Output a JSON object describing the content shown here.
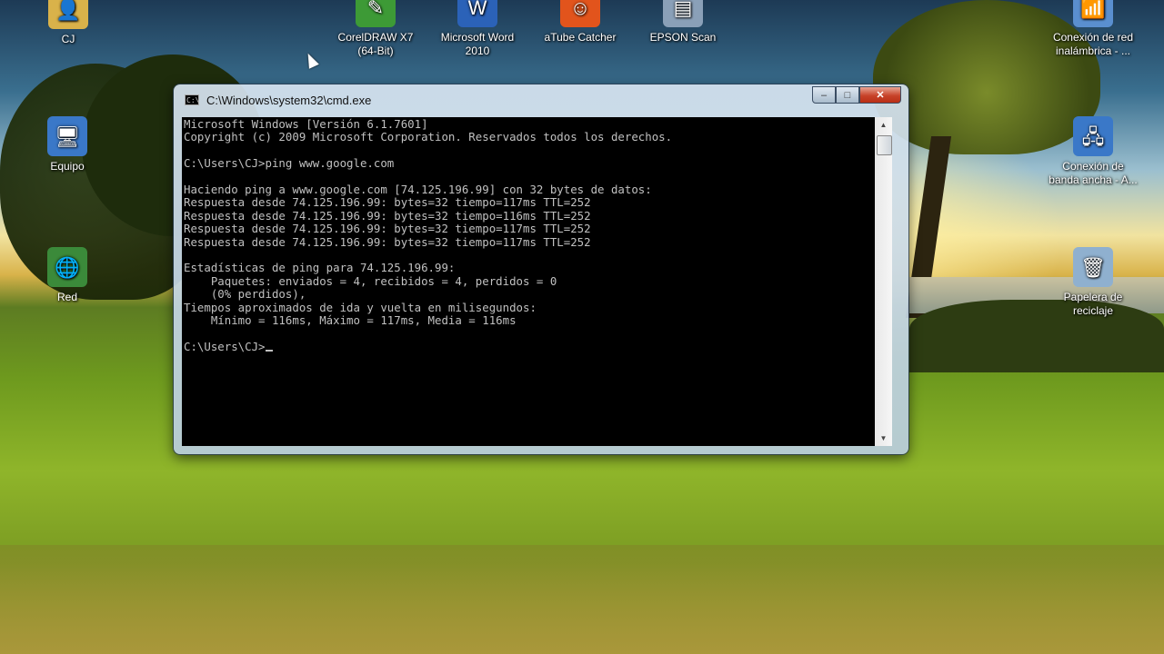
{
  "desktop": {
    "icons": [
      {
        "label": "CJ",
        "glyph": "👤",
        "color": "#d9b24a"
      },
      {
        "label": "CorelDRAW X7\n(64-Bit)",
        "glyph": "✎",
        "color": "#3d9a36"
      },
      {
        "label": "Microsoft Word\n2010",
        "glyph": "W",
        "color": "#2b62b8"
      },
      {
        "label": "aTube Catcher",
        "glyph": "☺",
        "color": "#e2541c"
      },
      {
        "label": "EPSON Scan",
        "glyph": "▤",
        "color": "#8aa0b8"
      },
      {
        "label": "Conexión de red\ninalámbrica - ...",
        "glyph": "📶",
        "color": "#5a8fcf"
      },
      {
        "label": "Equipo",
        "glyph": "🖥",
        "color": "#3a78c8"
      },
      {
        "label": "Conexión de\nbanda ancha - A...",
        "glyph": "🖧",
        "color": "#3a78c8"
      },
      {
        "label": "Red",
        "glyph": "🌐",
        "color": "#3b8a3a"
      },
      {
        "label": "Papelera de\nreciclaje",
        "glyph": "🗑",
        "color": "#8fb0cf"
      }
    ]
  },
  "window": {
    "title": "C:\\Windows\\system32\\cmd.exe",
    "icon": "cmd-icon",
    "controls": {
      "minimize": "–",
      "maximize": "□",
      "close": "✕"
    }
  },
  "console": {
    "lines": [
      "Microsoft Windows [Versión 6.1.7601]",
      "Copyright (c) 2009 Microsoft Corporation. Reservados todos los derechos.",
      "",
      "C:\\Users\\CJ>ping www.google.com",
      "",
      "Haciendo ping a www.google.com [74.125.196.99] con 32 bytes de datos:",
      "Respuesta desde 74.125.196.99: bytes=32 tiempo=117ms TTL=252",
      "Respuesta desde 74.125.196.99: bytes=32 tiempo=116ms TTL=252",
      "Respuesta desde 74.125.196.99: bytes=32 tiempo=117ms TTL=252",
      "Respuesta desde 74.125.196.99: bytes=32 tiempo=117ms TTL=252",
      "",
      "Estadísticas de ping para 74.125.196.99:",
      "    Paquetes: enviados = 4, recibidos = 4, perdidos = 0",
      "    (0% perdidos),",
      "Tiempos aproximados de ida y vuelta en milisegundos:",
      "    Mínimo = 116ms, Máximo = 117ms, Media = 116ms",
      ""
    ],
    "prompt": "C:\\Users\\CJ>"
  }
}
